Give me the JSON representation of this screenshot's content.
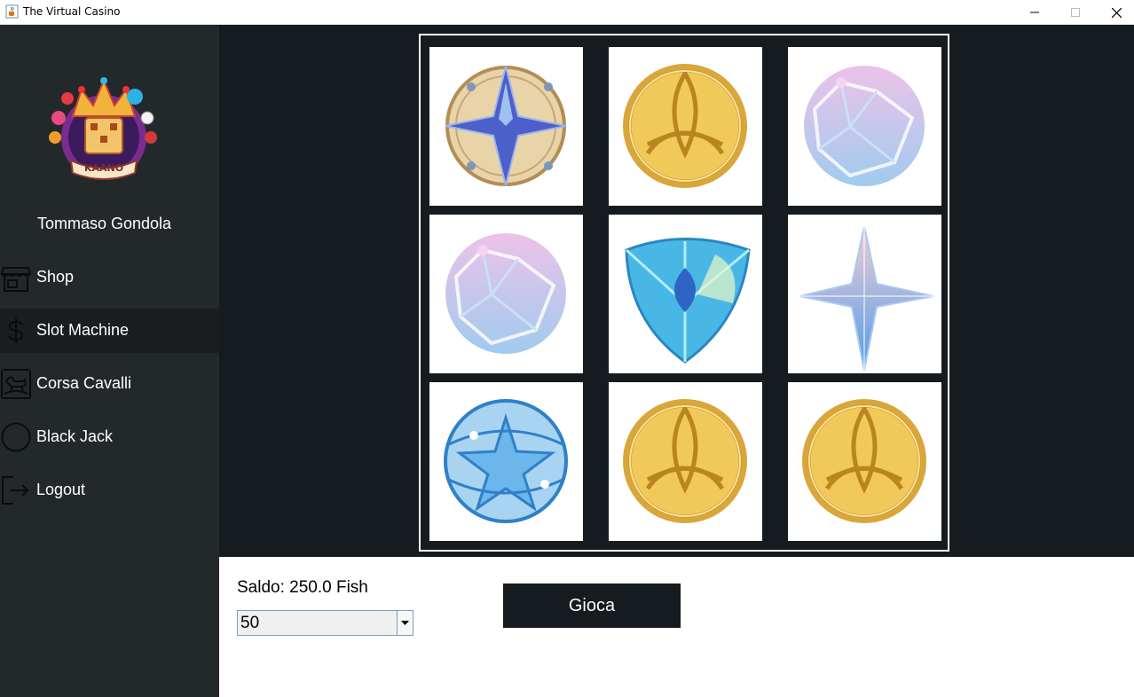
{
  "window": {
    "title": "The Virtual Casino",
    "app_icon": "java-cup-icon",
    "controls": [
      "minimize-icon",
      "maximize-icon",
      "close-icon"
    ]
  },
  "sidebar": {
    "logo": "casino-crown-logo",
    "logo_text": "KAANO",
    "user_name": "Tommaso Gondola",
    "items": [
      {
        "label": "Shop",
        "icon": "store-icon",
        "active": false
      },
      {
        "label": "Slot Machine",
        "icon": "dollar-icon",
        "active": true
      },
      {
        "label": "Corsa Cavalli",
        "icon": "rocking-horse-icon",
        "active": false
      },
      {
        "label": "Black Jack",
        "icon": "circle-icon",
        "active": false
      },
      {
        "label": "Logout",
        "icon": "logout-icon",
        "active": false
      }
    ]
  },
  "slot": {
    "grid": [
      [
        "star-compass-emblem",
        "gold-coin-emblem",
        "pink-crystal-sphere"
      ],
      [
        "pink-crystal-sphere",
        "blue-crystal-shield",
        "blue-four-point-star"
      ],
      [
        "blue-star-sphere",
        "gold-coin-emblem",
        "gold-coin-emblem"
      ]
    ]
  },
  "controls": {
    "balance_text": "Saldo: 250.0 Fish",
    "bet_value": "50",
    "play_label": "Gioca"
  },
  "colors": {
    "sidebar_bg": "#23282b",
    "sidebar_active_bg": "#1a1e21",
    "slot_bg": "#161b1f",
    "button_bg": "#161b1f",
    "gold": "#e3b54a",
    "blue": "#5aa0e0",
    "pink": "#e2a6dc"
  }
}
